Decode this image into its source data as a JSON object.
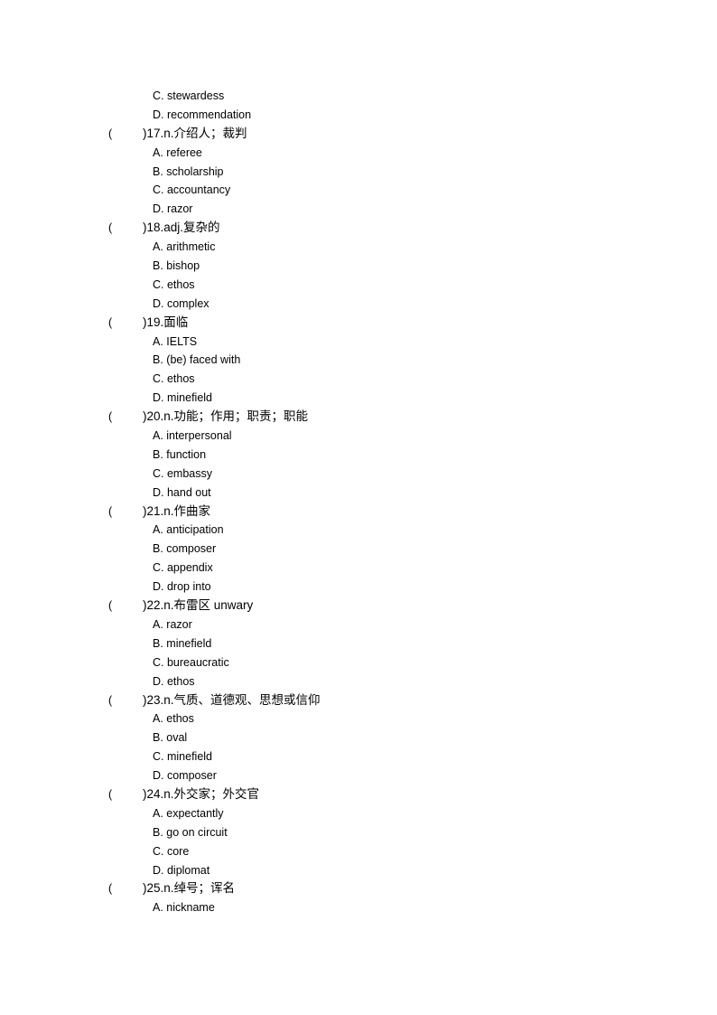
{
  "leading_options": [
    {
      "letter": "C",
      "text": "C. stewardess"
    },
    {
      "letter": "D",
      "text": "D. recommendation"
    }
  ],
  "questions": [
    {
      "number": 17,
      "open_paren": "(",
      "prompt": ")17.n.介绍人；裁判",
      "options": [
        "A. referee",
        "B. scholarship",
        "C. accountancy",
        "D. razor"
      ]
    },
    {
      "number": 18,
      "open_paren": "(",
      "prompt": ")18.adj.复杂的",
      "options": [
        "A. arithmetic",
        "B. bishop",
        "C. ethos",
        "D. complex"
      ]
    },
    {
      "number": 19,
      "open_paren": "(",
      "prompt": ")19.面临",
      "options": [
        "A. IELTS",
        "B. (be) faced with",
        "C. ethos",
        "D. minefield"
      ]
    },
    {
      "number": 20,
      "open_paren": "(",
      "prompt": ")20.n.功能；作用；职责；职能",
      "options": [
        "A. interpersonal",
        "B. function",
        "C. embassy",
        "D. hand out"
      ]
    },
    {
      "number": 21,
      "open_paren": "(",
      "prompt": ")21.n.作曲家",
      "options": [
        "A. anticipation",
        "B. composer",
        "C. appendix",
        "D. drop into"
      ]
    },
    {
      "number": 22,
      "open_paren": "(",
      "prompt": ")22.n.布雷区 unwary",
      "options": [
        "A. razor",
        "B. minefield",
        "C. bureaucratic",
        "D. ethos"
      ]
    },
    {
      "number": 23,
      "open_paren": "(",
      "prompt": ")23.n.气质、道德观、思想或信仰",
      "options": [
        "A. ethos",
        "B. oval",
        "C. minefield",
        "D. composer"
      ]
    },
    {
      "number": 24,
      "open_paren": "(",
      "prompt": ")24.n.外交家；外交官",
      "options": [
        "A. expectantly",
        "B. go on circuit",
        "C. core",
        "D. diplomat"
      ]
    },
    {
      "number": 25,
      "open_paren": "(",
      "prompt": ")25.n.绰号；诨名",
      "options": [
        "A. nickname"
      ]
    }
  ]
}
